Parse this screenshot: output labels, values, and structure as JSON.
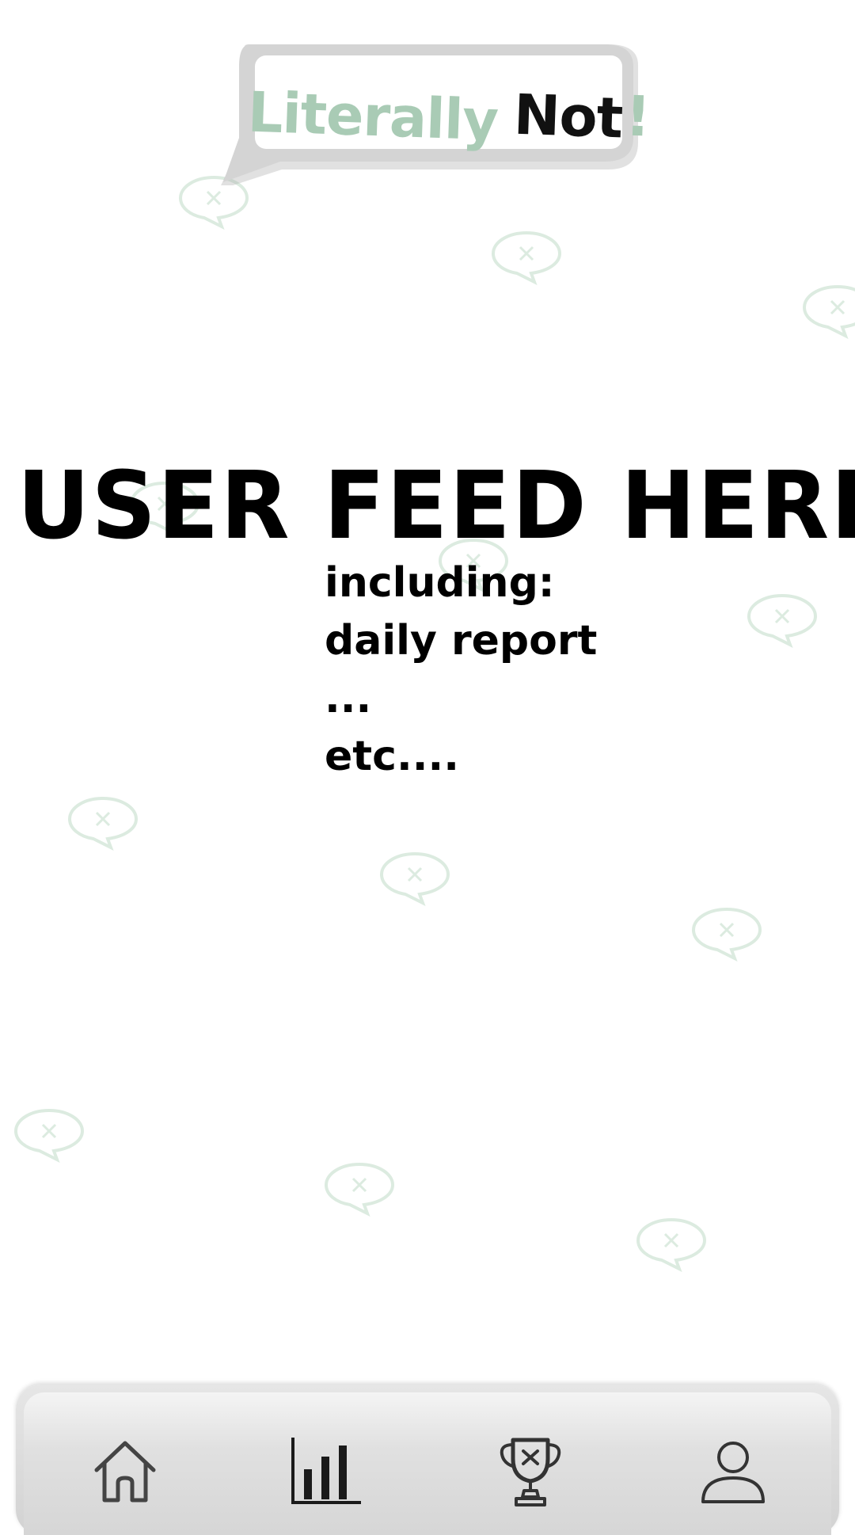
{
  "app": {
    "logo_word_1": "Literally",
    "logo_word_2": "Not",
    "logo_mark": "!"
  },
  "feed": {
    "heading": "USER FEED HERE",
    "lines": [
      "including:",
      "daily report",
      "...",
      "etc...."
    ]
  },
  "nav": {
    "items": [
      {
        "icon": "home-icon"
      },
      {
        "icon": "bar-chart-icon"
      },
      {
        "icon": "trophy-icon"
      },
      {
        "icon": "profile-icon"
      }
    ]
  },
  "colors": {
    "brand_green": "#a9cbb5",
    "bubble_gray": "#d4d4d4",
    "pattern_green": "#dcebe0",
    "text": "#000000"
  }
}
